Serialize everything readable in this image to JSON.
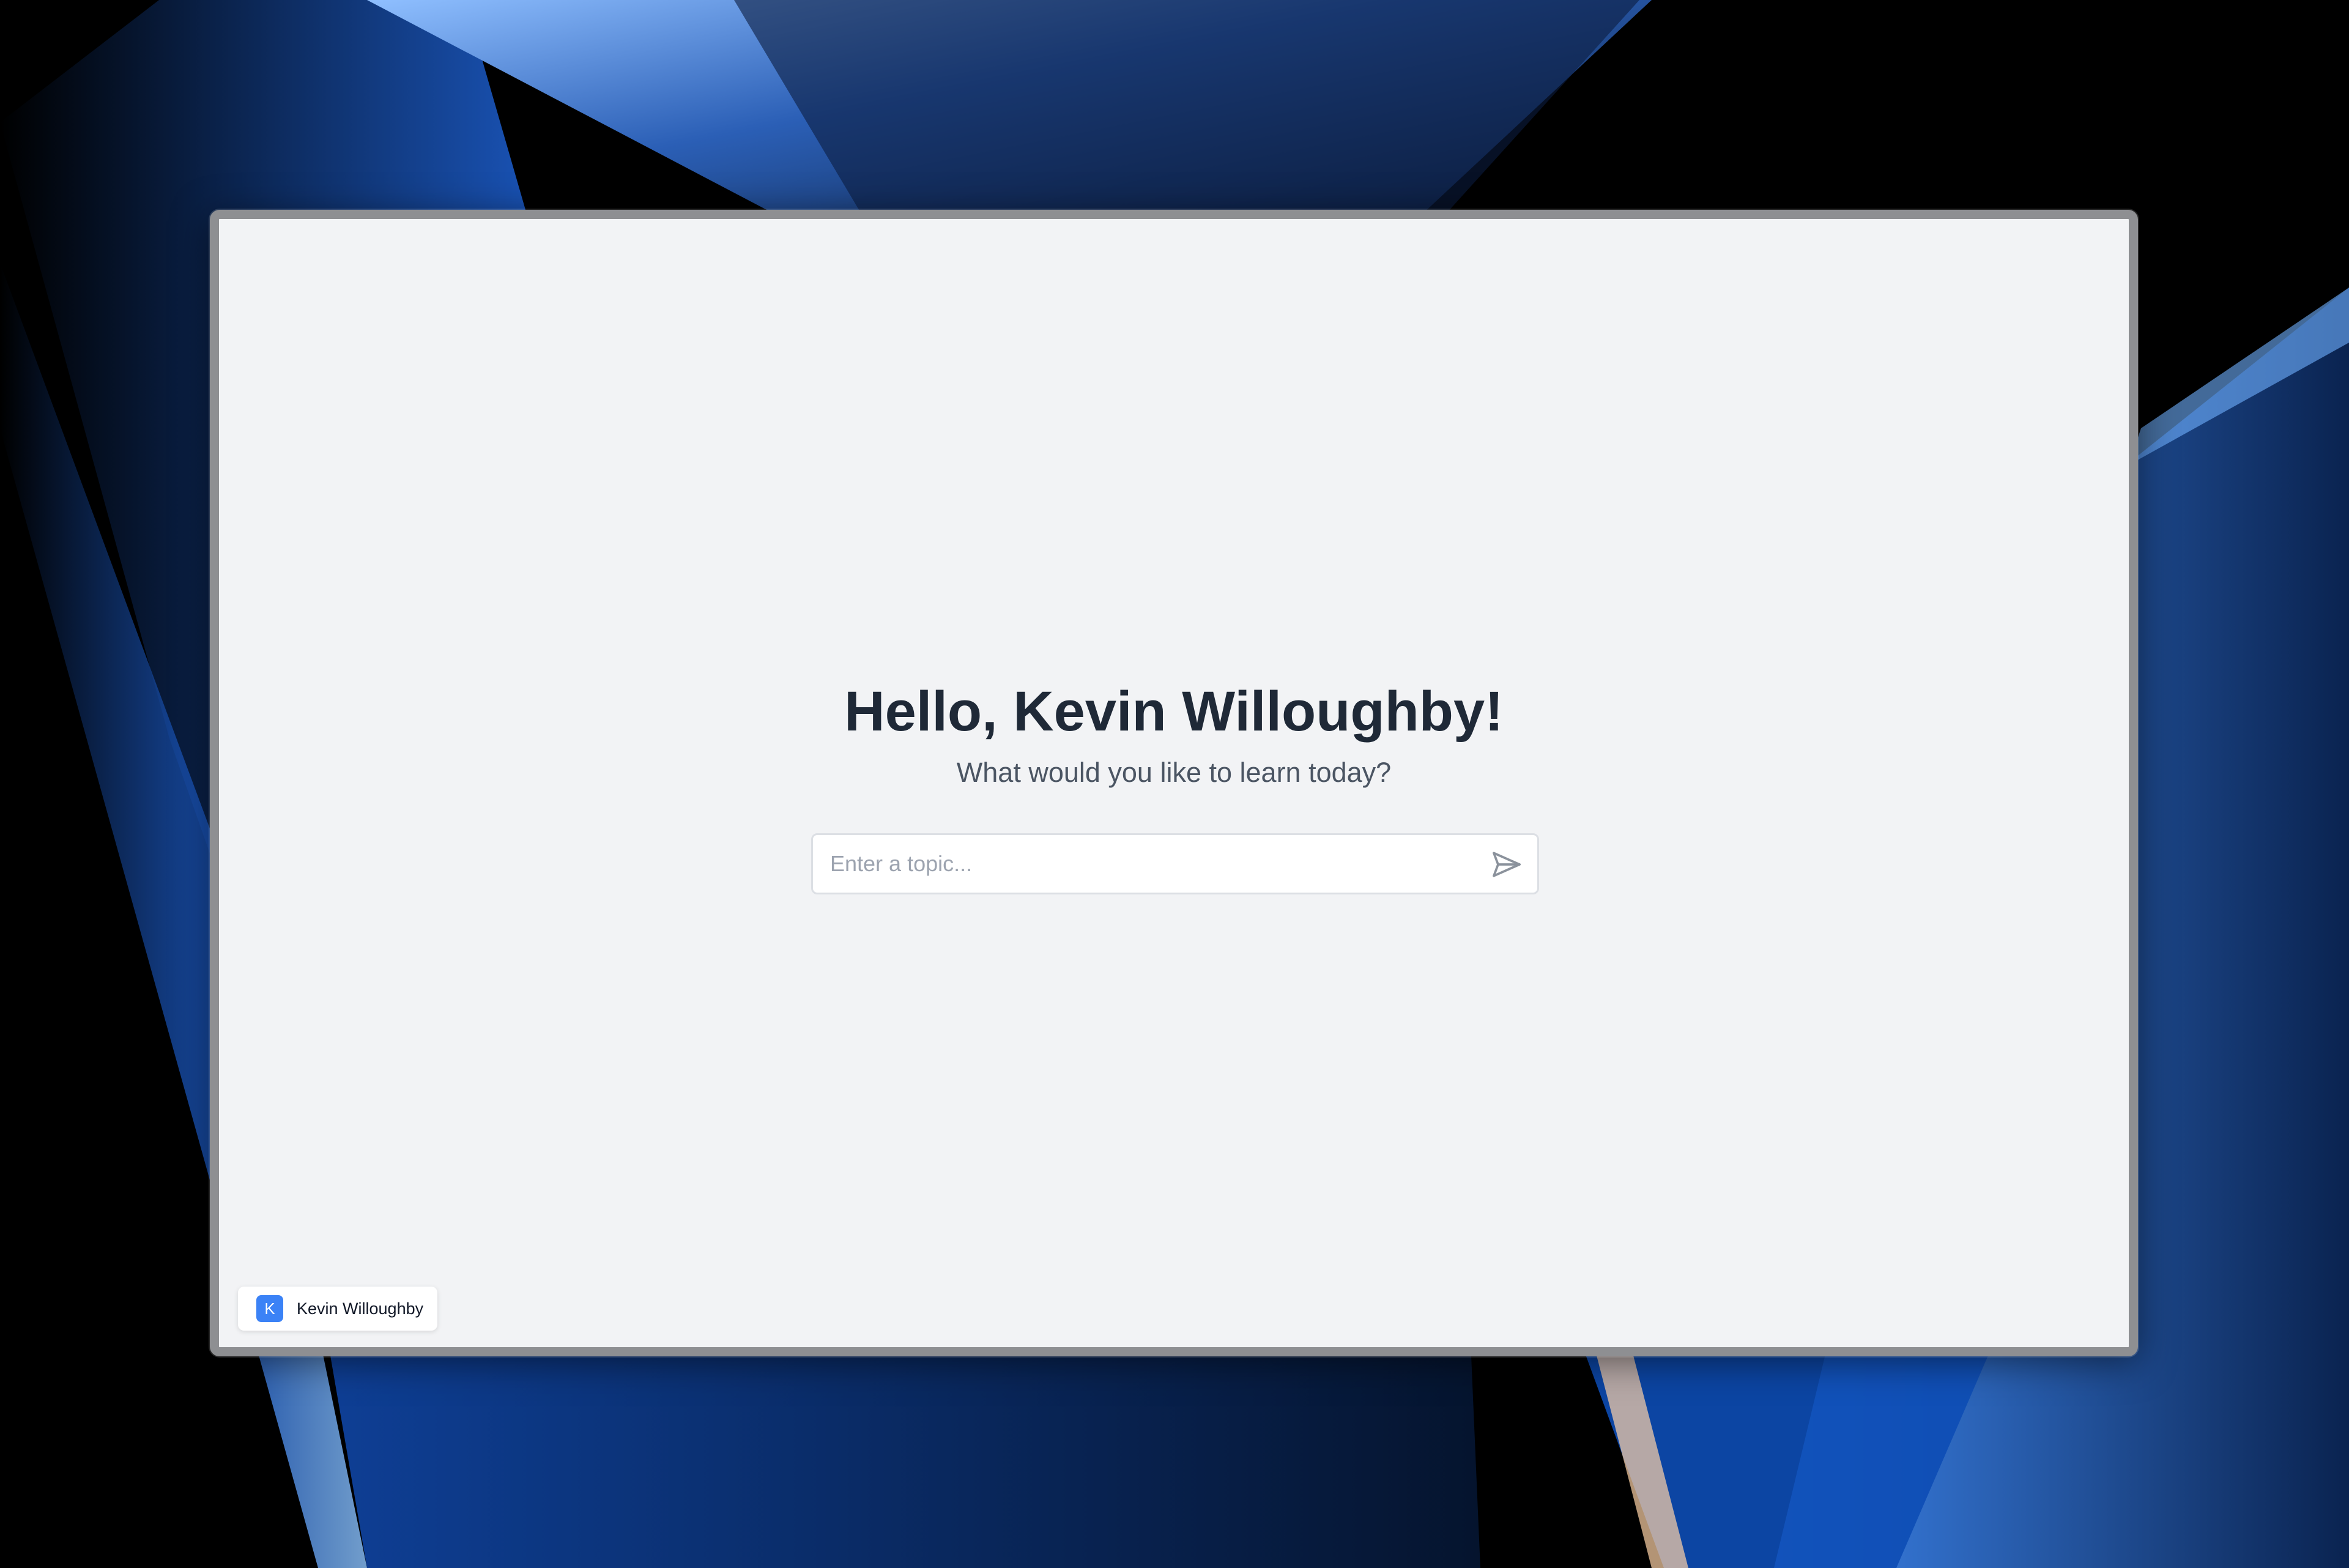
{
  "main": {
    "greeting": "Hello, Kevin Willoughby!",
    "subtitle": "What would you like to learn today?"
  },
  "search": {
    "placeholder": "Enter a topic...",
    "value": "",
    "send_icon": "send-icon"
  },
  "user": {
    "avatar_initial": "K",
    "name": "Kevin Willoughby",
    "avatar_color": "#3b82f6"
  },
  "theme": {
    "window_background": "#f2f3f5",
    "heading_color": "#1f2937",
    "subtitle_color": "#4b5563"
  }
}
